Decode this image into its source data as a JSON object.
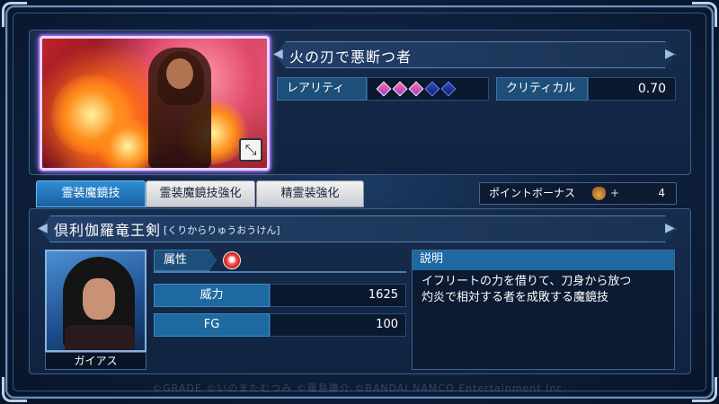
{
  "card": {
    "title": "火の刃で悪断つ者",
    "expand_icon": "expand-arrows-icon"
  },
  "stats_top": {
    "rarity_label": "レアリティ",
    "rarity_filled": 3,
    "rarity_total": 5,
    "critical_label": "クリティカル",
    "critical_value": "0.70"
  },
  "tabs": [
    {
      "label": "霊装魔鏡技",
      "active": true
    },
    {
      "label": "霊装魔鏡技強化",
      "active": false
    },
    {
      "label": "精霊装強化",
      "active": false
    }
  ],
  "point_bonus": {
    "label": "ポイントボーナス",
    "plus": "+",
    "value": "4",
    "icon": "money-bag-icon"
  },
  "skill": {
    "name": "倶利伽羅竜王剣",
    "reading": "[くりからりゅうおうけん]",
    "character_name": "ガイアス",
    "attribute_label": "属性",
    "attribute_icon": "fire-element-icon",
    "power_label": "威力",
    "power_value": "1625",
    "fg_label": "FG",
    "fg_value": "100",
    "description_header": "説明",
    "description_line1": "イフリートの力を借りて、刀身から放つ",
    "description_line2": "灼炎で相対する者を成敗する魔鏡技"
  },
  "footer": {
    "watermark": "©GRADE ©いのまたむつみ ©藤島康介 ©BANDAI NAMCO Entertainment Inc."
  },
  "colors": {
    "accent_blue": "#1e6aa0",
    "panel_bg": "#102340",
    "gem_on": "#e04ab0",
    "gem_off": "#2a49c8"
  }
}
